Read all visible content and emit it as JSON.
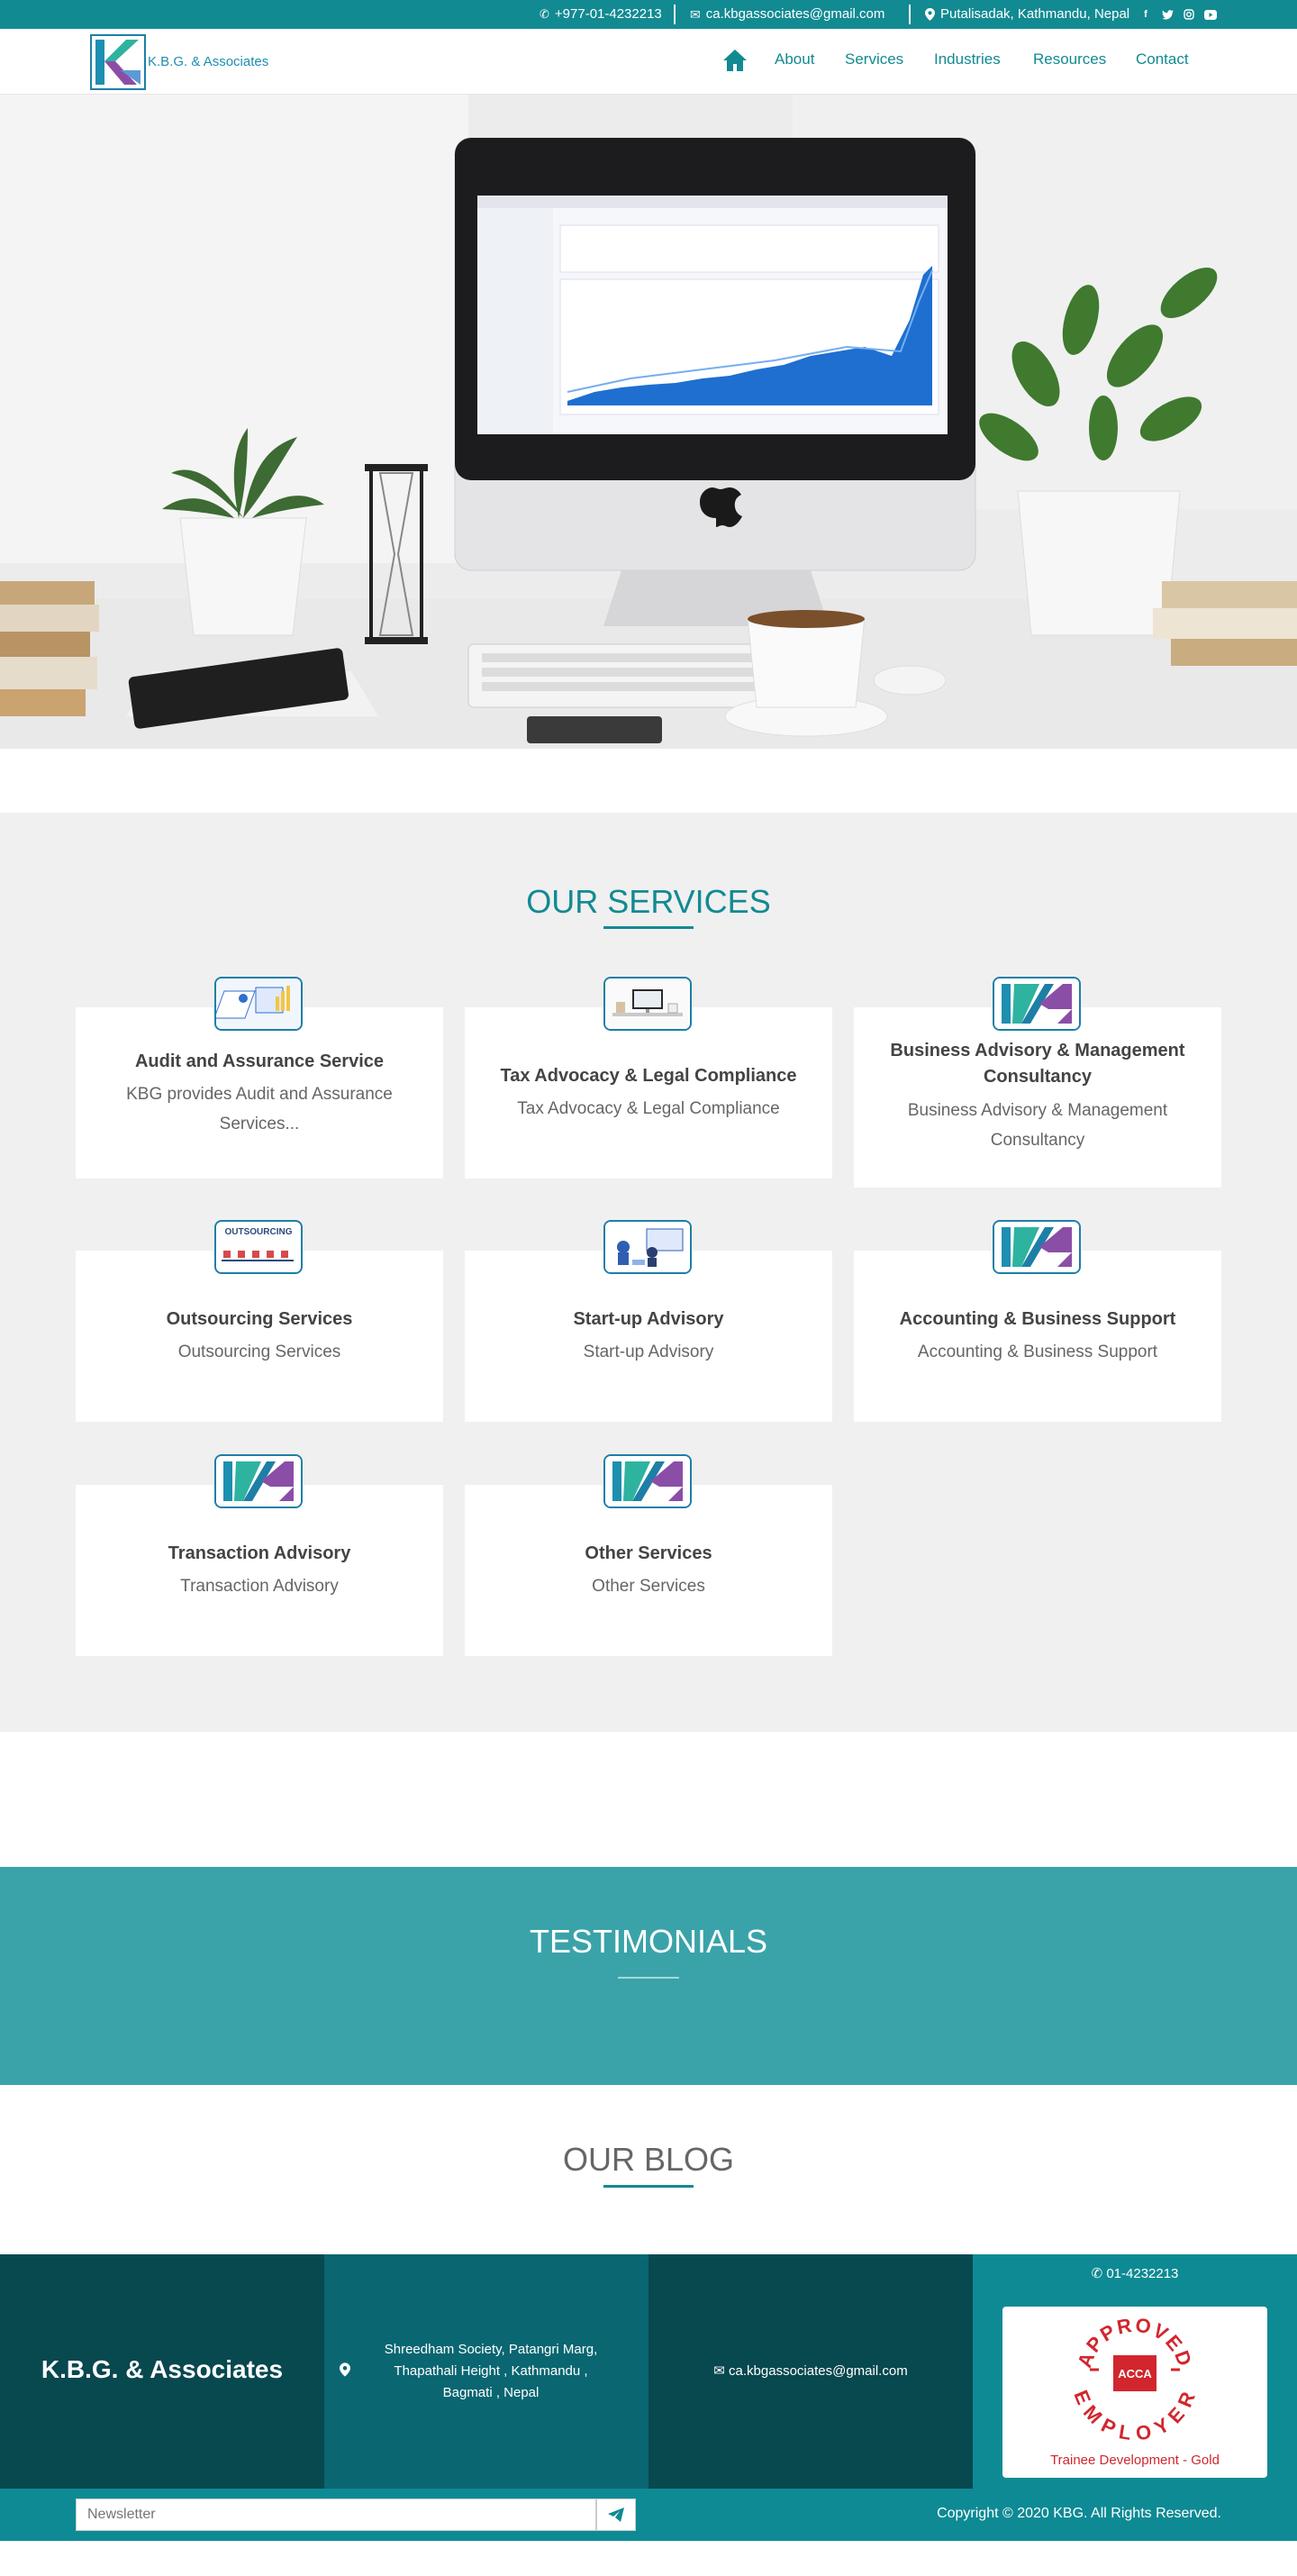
{
  "colors": {
    "brand_teal": "#128a92",
    "services_bg": "#f0f0f0",
    "testimonials_bg": "#3aa3a9",
    "footer_dark": "#08484f",
    "footer_mid": "#0a6671",
    "footer_light": "#0e8a94"
  },
  "topbar": {
    "phone": "+977-01-4232213",
    "email": "ca.kbgassociates@gmail.com",
    "address": "Putalisadak, Kathmandu, Nepal",
    "social_icons": [
      "facebook-icon",
      "twitter-icon",
      "instagram-icon",
      "youtube-icon"
    ]
  },
  "header": {
    "logo_text": "K.B.G. & Associates",
    "nav": [
      {
        "label": "About"
      },
      {
        "label": "Services"
      },
      {
        "label": "Industries"
      },
      {
        "label": "Resources"
      },
      {
        "label": "Contact"
      }
    ]
  },
  "services": {
    "title": "OUR SERVICES",
    "cards": [
      {
        "title": "Audit and Assurance Service",
        "desc": "KBG provides Audit and Assurance Services...",
        "icon": "audit-icon"
      },
      {
        "title": "Tax Advocacy & Legal Compliance",
        "desc": "Tax Advocacy & Legal Compliance",
        "icon": "tax-icon"
      },
      {
        "title": "Business Advisory & Management Consultancy",
        "desc": "Business Advisory & Management Consultancy",
        "icon": "kbg-logo-icon"
      },
      {
        "title": "Outsourcing Services",
        "desc": "Outsourcing Services",
        "icon": "outsourcing-icon",
        "icon_text": "OUTSOURCING"
      },
      {
        "title": "Start-up Advisory",
        "desc": "Start-up Advisory",
        "icon": "startup-icon"
      },
      {
        "title": "Accounting & Business Support",
        "desc": "Accounting & Business Support",
        "icon": "kbg-logo-icon"
      },
      {
        "title": "Transaction Advisory",
        "desc": "Transaction Advisory",
        "icon": "kbg-logo-icon"
      },
      {
        "title": "Other Services",
        "desc": "Other Services",
        "icon": "kbg-logo-icon"
      }
    ]
  },
  "testimonials": {
    "title": "TESTIMONIALS"
  },
  "blog": {
    "title": "OUR BLOG"
  },
  "footer": {
    "brand": "K.B.G. & Associates",
    "address": "Shreedham Society, Patangri Marg, Thapathali Height , Kathmandu , Bagmati , Nepal",
    "email": "ca.kbgassociates@gmail.com",
    "phone": "01-4232213",
    "badge_top": "APPROVED",
    "badge_mid": "ACCA",
    "badge_bottom": "EMPLOYER",
    "badge_caption": "Trainee Development - Gold",
    "newsletter_placeholder": "Newsletter",
    "copyright": "Copyright © 2020 KBG. All Rights Reserved."
  }
}
